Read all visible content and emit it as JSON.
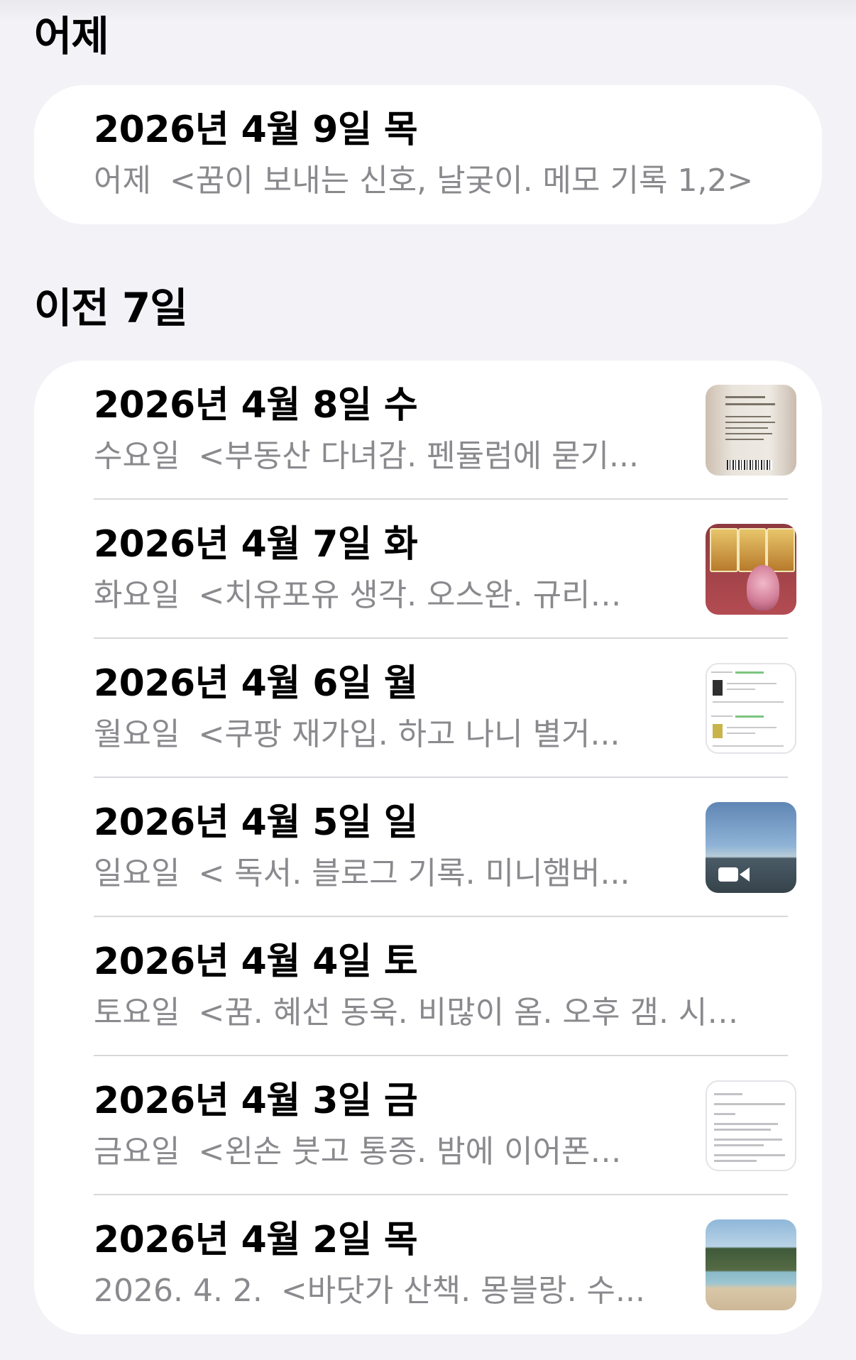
{
  "sections": [
    {
      "header": "어제",
      "entries": [
        {
          "title": "2026년 4월 9일 목",
          "prefix": "어제",
          "preview": "<꿈이 보내는 신호, 날궂이. 메모 기록 1,2>",
          "thumbnail": null
        }
      ]
    },
    {
      "header": "이전 7일",
      "entries": [
        {
          "title": "2026년 4월 8일 수",
          "prefix": "수요일",
          "preview": "<부동산 다녀감. 펜듈럼에 묻기...",
          "thumbnail": "product-label-photo"
        },
        {
          "title": "2026년 4월 7일 화",
          "prefix": "화요일",
          "preview": "<치유포유 생각. 오스완. 규리…",
          "thumbnail": "tarot-cards-photo"
        },
        {
          "title": "2026년 4월 6일 월",
          "prefix": "월요일",
          "preview": "<쿠팡 재가입. 하고 나니 별거...",
          "thumbnail": "shopping-app-screenshot"
        },
        {
          "title": "2026년 4월 5일 일",
          "prefix": "일요일",
          "preview": "< 독서. 블로그 기록. 미니햄버...",
          "thumbnail": "sea-video"
        },
        {
          "title": "2026년 4월 4일 토",
          "prefix": "토요일",
          "preview": "<꿈. 혜선 동욱. 비많이 옴. 오후 갬. 시…",
          "thumbnail": null
        },
        {
          "title": "2026년 4월 3일 금",
          "prefix": "금요일",
          "preview": "<왼손 붓고 통증. 밤에 이어폰…",
          "thumbnail": "document-screenshot"
        },
        {
          "title": "2026년 4월 2일 목",
          "prefix": "2026. 4. 2.",
          "preview": "<바닷가 산책. 몽블랑. 수...",
          "thumbnail": "beach-photo"
        }
      ]
    }
  ]
}
